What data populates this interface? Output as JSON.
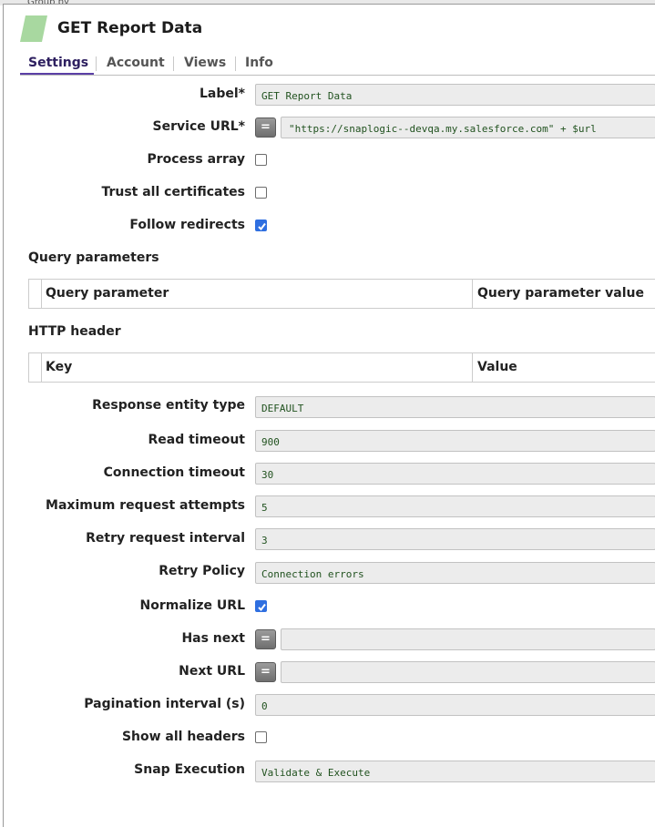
{
  "background": {
    "peek_text": "Group by"
  },
  "header": {
    "title": "GET Report Data",
    "icon": "snap-parallelogram-icon",
    "icon_color": "#a8d8a0"
  },
  "tabs": [
    {
      "label": "Settings",
      "active": true
    },
    {
      "label": "Account",
      "active": false
    },
    {
      "label": "Views",
      "active": false
    },
    {
      "label": "Info",
      "active": false
    }
  ],
  "fields": {
    "label": {
      "label": "Label*",
      "value": "GET Report Data"
    },
    "service_url": {
      "label": "Service URL*",
      "expr_button": "=",
      "value": "\"https://snaplogic--devqa.my.salesforce.com\" + $url"
    },
    "process_array": {
      "label": "Process array",
      "checked": false
    },
    "trust_all_certificates": {
      "label": "Trust all certificates",
      "checked": false
    },
    "follow_redirects": {
      "label": "Follow redirects",
      "checked": true
    },
    "response_entity_type": {
      "label": "Response entity type",
      "value": "DEFAULT"
    },
    "read_timeout": {
      "label": "Read timeout",
      "value": "900"
    },
    "connection_timeout": {
      "label": "Connection timeout",
      "value": "30"
    },
    "maximum_request_attempts": {
      "label": "Maximum request attempts",
      "value": "5"
    },
    "retry_request_interval": {
      "label": "Retry request interval",
      "value": "3"
    },
    "retry_policy": {
      "label": "Retry Policy",
      "value": "Connection errors"
    },
    "normalize_url": {
      "label": "Normalize URL",
      "checked": true
    },
    "has_next": {
      "label": "Has next",
      "expr_button": "=",
      "value": ""
    },
    "next_url": {
      "label": "Next URL",
      "expr_button": "=",
      "value": ""
    },
    "pagination_interval": {
      "label": "Pagination interval (s)",
      "value": "0"
    },
    "show_all_headers": {
      "label": "Show all headers",
      "checked": false
    },
    "snap_execution": {
      "label": "Snap Execution",
      "value": "Validate & Execute"
    }
  },
  "query_parameters": {
    "title": "Query parameters",
    "columns": [
      "Query parameter",
      "Query parameter value"
    ]
  },
  "http_header": {
    "title": "HTTP header",
    "columns": [
      "Key",
      "Value"
    ]
  },
  "colors": {
    "accent": "#5b3fa6",
    "checkbox_checked": "#2f6fe0",
    "input_text": "#21521f",
    "input_bg": "#ececec"
  }
}
